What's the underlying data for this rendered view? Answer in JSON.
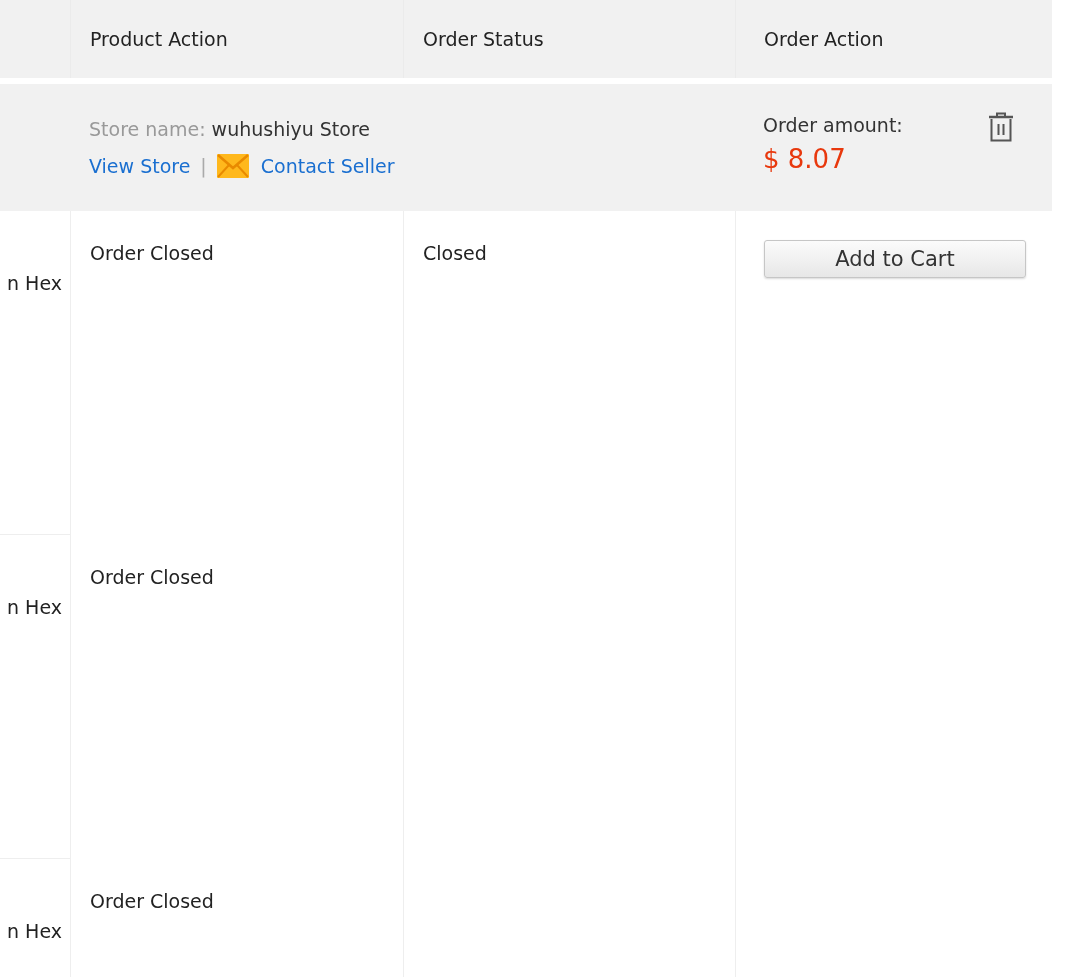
{
  "table": {
    "columns": [
      "Product Action",
      "Order Status",
      "Order Action"
    ]
  },
  "order": {
    "store_label": "Store name:",
    "store_name": "wuhushiyu Store",
    "links": [
      {
        "kind": "link",
        "label": "View Store"
      },
      {
        "kind": "contact",
        "label": "Contact Seller"
      }
    ],
    "separator": "|",
    "amount_label": "Order amount:",
    "amount": "$ 8.07"
  },
  "products": [
    {
      "column_1": "n Hex",
      "product_action": "Order Closed"
    },
    {
      "column_1": "n Hex",
      "product_action": "Order Closed"
    },
    {
      "column_1": "n Hex",
      "product_action": "Order Closed"
    }
  ],
  "order_status": "Closed",
  "order_action": {
    "button": "Add to Cart"
  }
}
